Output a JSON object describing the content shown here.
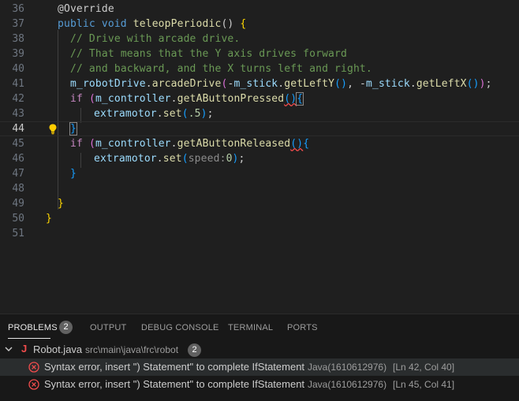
{
  "editor": {
    "lines": [
      {
        "num": "36",
        "tokens": [
          [
            "@Override",
            "t-pun"
          ]
        ]
      },
      {
        "num": "37",
        "tokens": [
          [
            "public",
            "t-kw"
          ],
          [
            " ",
            "t-pun"
          ],
          [
            "void",
            "t-kw"
          ],
          [
            " ",
            "t-pun"
          ],
          [
            "teleopPeriodic",
            "t-fn"
          ],
          [
            "() ",
            "t-pun"
          ],
          [
            "{",
            "t-p1"
          ]
        ]
      },
      {
        "num": "38",
        "tokens": [
          [
            "// Drive with arcade drive.",
            "t-cm"
          ]
        ]
      },
      {
        "num": "39",
        "tokens": [
          [
            "// That means that the Y axis drives forward",
            "t-cm"
          ]
        ]
      },
      {
        "num": "40",
        "tokens": [
          [
            "// and backward, and the X turns left and right.",
            "t-cm"
          ]
        ]
      },
      {
        "num": "41",
        "tokens": [
          [
            "m_robotDrive",
            "t-var"
          ],
          [
            ".",
            "t-pun"
          ],
          [
            "arcadeDrive",
            "t-fn"
          ],
          [
            "(",
            "t-p2"
          ],
          [
            "-",
            "t-pun"
          ],
          [
            "m_stick",
            "t-var"
          ],
          [
            ".",
            "t-pun"
          ],
          [
            "getLeftY",
            "t-fn"
          ],
          [
            "()",
            "t-p3"
          ],
          [
            ", -",
            "t-pun"
          ],
          [
            "m_stick",
            "t-var"
          ],
          [
            ".",
            "t-pun"
          ],
          [
            "getLeftX",
            "t-fn"
          ],
          [
            "()",
            "t-p3"
          ],
          [
            ")",
            "t-p2"
          ],
          [
            ";",
            "t-pun"
          ]
        ]
      },
      {
        "num": "42",
        "tokens": [
          [
            "if",
            "t-kw2"
          ],
          [
            " ",
            "t-pun"
          ],
          [
            "(",
            "t-p2"
          ],
          [
            "m_controller",
            "t-var"
          ],
          [
            ".",
            "t-pun"
          ],
          [
            "getAButtonPressed",
            "t-fn"
          ],
          [
            "()",
            "t-p3"
          ],
          [
            "{",
            "t-p3"
          ]
        ]
      },
      {
        "num": "43",
        "tokens": [
          [
            "extramotor",
            "t-var"
          ],
          [
            ".",
            "t-pun"
          ],
          [
            "set",
            "t-fn"
          ],
          [
            "(",
            "t-p3"
          ],
          [
            ".5",
            "t-num"
          ],
          [
            ")",
            "t-p3"
          ],
          [
            ";",
            "t-pun"
          ]
        ]
      },
      {
        "num": "44",
        "tokens": [
          [
            "}",
            "t-p3"
          ]
        ]
      },
      {
        "num": "45",
        "tokens": [
          [
            "if",
            "t-kw2"
          ],
          [
            " ",
            "t-pun"
          ],
          [
            "(",
            "t-p2"
          ],
          [
            "m_controller",
            "t-var"
          ],
          [
            ".",
            "t-pun"
          ],
          [
            "getAButtonReleased",
            "t-fn"
          ],
          [
            "()",
            "t-p3"
          ],
          [
            "{",
            "t-p3"
          ]
        ]
      },
      {
        "num": "46",
        "tokens": [
          [
            "extramotor",
            "t-var"
          ],
          [
            ".",
            "t-pun"
          ],
          [
            "set",
            "t-fn"
          ],
          [
            "(",
            "t-p3"
          ],
          [
            "speed:",
            "t-hint"
          ],
          [
            "0",
            "t-num"
          ],
          [
            ")",
            "t-p3"
          ],
          [
            ";",
            "t-pun"
          ]
        ]
      },
      {
        "num": "47",
        "tokens": [
          [
            "}",
            "t-p3"
          ]
        ]
      },
      {
        "num": "48",
        "tokens": []
      },
      {
        "num": "49",
        "tokens": [
          [
            "}",
            "t-p1"
          ]
        ]
      },
      {
        "num": "50",
        "tokens": [
          [
            "}",
            "t-p1"
          ]
        ]
      },
      {
        "num": "51",
        "tokens": []
      }
    ],
    "active_line": "44"
  },
  "panel": {
    "tabs": {
      "problems": "PROBLEMS",
      "problems_count": "2",
      "output": "OUTPUT",
      "debug_console": "DEBUG CONSOLE",
      "terminal": "TERMINAL",
      "ports": "PORTS"
    },
    "file": {
      "icon": "J",
      "name": "Robot.java",
      "path": "src\\main\\java\\frc\\robot",
      "count": "2"
    },
    "problems": [
      {
        "message": "Syntax error, insert \") Statement\" to complete IfStatement",
        "source": "Java(1610612976)",
        "location": "[Ln 42, Col 40]"
      },
      {
        "message": "Syntax error, insert \") Statement\" to complete IfStatement",
        "source": "Java(1610612976)",
        "location": "[Ln 45, Col 41]"
      }
    ]
  },
  "colors": {
    "error": "#f14c4c",
    "lightbulb": "#ffcc00",
    "java_icon": "#f14c4c"
  }
}
